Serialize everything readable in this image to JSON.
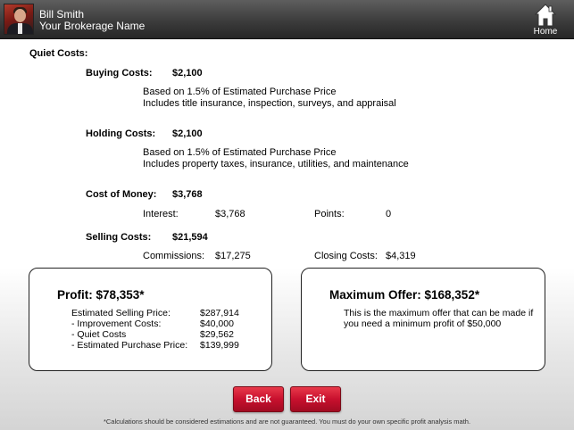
{
  "header": {
    "agent_name": "Bill Smith",
    "brokerage": "Your Brokerage Name",
    "home_label": "Home",
    "home_icon": "home-icon",
    "avatar": "agent-photo"
  },
  "quiet_costs": {
    "label": "Quiet Costs:",
    "buying": {
      "label": "Buying Costs:",
      "value": "$2,100",
      "line1": "Based on 1.5% of Estimated Purchase Price",
      "line2": "Includes title insurance, inspection, surveys, and appraisal"
    },
    "holding": {
      "label": "Holding Costs:",
      "value": "$2,100",
      "line1": "Based on 1.5% of Estimated Purchase Price",
      "line2": "Includes property taxes, insurance, utilities, and maintenance"
    },
    "cost_of_money": {
      "label": "Cost of Money:",
      "value": "$3,768",
      "interest_label": "Interest:",
      "interest_value": "$3,768",
      "points_label": "Points:",
      "points_value": "0"
    },
    "selling": {
      "label": "Selling Costs:",
      "value": "$21,594",
      "commissions_label": "Commissions:",
      "commissions_value": "$17,275",
      "closing_label": "Closing Costs:",
      "closing_value": "$4,319"
    }
  },
  "profit": {
    "title": "Profit:  $78,353*",
    "rows": [
      {
        "label": "Estimated Selling Price:",
        "value": "$287,914"
      },
      {
        "label": "- Improvement Costs:",
        "value": "$40,000"
      },
      {
        "label": "- Quiet Costs",
        "value": "$29,562"
      },
      {
        "label": "- Estimated Purchase Price:",
        "value": "$139,999"
      }
    ]
  },
  "max_offer": {
    "title": "Maximum Offer:  $168,352*",
    "line1": "This is the maximum offer that can be made if",
    "line2": "you need a minimum profit of $50,000"
  },
  "buttons": {
    "back": "Back",
    "exit": "Exit"
  },
  "disclaimer": "*Calculations should be considered estimations and are not guaranteed. You must do your own specific profit analysis math.",
  "colors": {
    "header_bg": "#3c3c3c",
    "button_red": "#c8102e"
  }
}
